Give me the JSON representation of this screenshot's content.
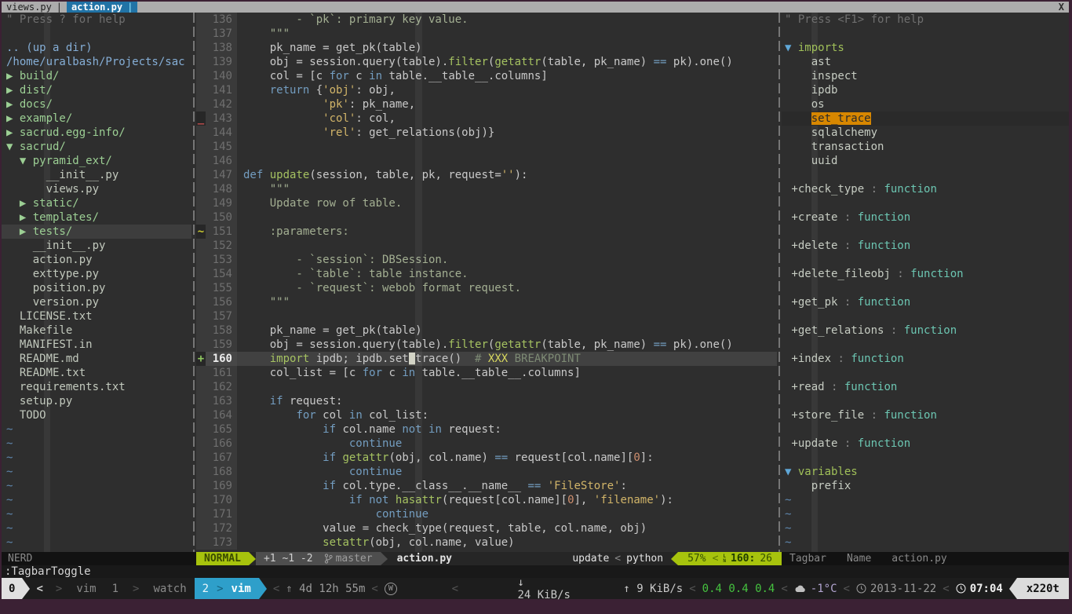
{
  "colors": {
    "accent_green": "#a7c30d",
    "tab_blue": "#2173a6",
    "tag_highlight_orange": "#d78700",
    "tmux_cyan": "#2e9fca",
    "load_green": "#45c33f",
    "temp_lavender": "#b2a4d0",
    "sign_add": "#8fc860",
    "sign_delete": "#c75050",
    "sign_change": "#c9c930"
  },
  "tabline": {
    "tabs": [
      {
        "name": "views.py",
        "pipe": "|",
        "active": false
      },
      {
        "name": "action.py",
        "pipe": "|",
        "active": true
      }
    ],
    "close_label": "X"
  },
  "nerdtree": {
    "help": "\" Press ? for help",
    "up_dir": ".. (up a dir)",
    "root_path": "/home/uralbash/Projects/sac",
    "items": [
      {
        "text": "build/",
        "kind": "dir",
        "prefix": "▶ ",
        "pad": 0
      },
      {
        "text": "dist/",
        "kind": "dir",
        "prefix": "▶ ",
        "pad": 0
      },
      {
        "text": "docs/",
        "kind": "dir",
        "prefix": "▶ ",
        "pad": 0
      },
      {
        "text": "example/",
        "kind": "dir",
        "prefix": "▶ ",
        "pad": 0
      },
      {
        "text": "sacrud.egg-info/",
        "kind": "dir",
        "prefix": "▶ ",
        "pad": 0
      },
      {
        "text": "sacrud/",
        "kind": "dir",
        "prefix": "▼ ",
        "pad": 0
      },
      {
        "text": "pyramid_ext/",
        "kind": "dir",
        "prefix": "▼ ",
        "pad": 1
      },
      {
        "text": "__init__.py",
        "kind": "file",
        "prefix": "",
        "pad": 3
      },
      {
        "text": "views.py",
        "kind": "file",
        "prefix": "",
        "pad": 3
      },
      {
        "text": "static/",
        "kind": "dir",
        "prefix": "▶ ",
        "pad": 1
      },
      {
        "text": "templates/",
        "kind": "dir",
        "prefix": "▶ ",
        "pad": 1
      },
      {
        "text": "tests/",
        "kind": "dir",
        "prefix": "▶ ",
        "pad": 1,
        "cursorline": true
      },
      {
        "text": "__init__.py",
        "kind": "file",
        "prefix": "",
        "pad": 2
      },
      {
        "text": "action.py",
        "kind": "file",
        "prefix": "",
        "pad": 2
      },
      {
        "text": "exttype.py",
        "kind": "file",
        "prefix": "",
        "pad": 2
      },
      {
        "text": "position.py",
        "kind": "file",
        "prefix": "",
        "pad": 2
      },
      {
        "text": "version.py",
        "kind": "file",
        "prefix": "",
        "pad": 2
      },
      {
        "text": "LICENSE.txt",
        "kind": "file",
        "prefix": "",
        "pad": 1
      },
      {
        "text": "Makefile",
        "kind": "file",
        "prefix": "",
        "pad": 1
      },
      {
        "text": "MANIFEST.in",
        "kind": "file",
        "prefix": "",
        "pad": 1
      },
      {
        "text": "README.md",
        "kind": "file",
        "prefix": "",
        "pad": 1
      },
      {
        "text": "README.txt",
        "kind": "file",
        "prefix": "",
        "pad": 1
      },
      {
        "text": "requirements.txt",
        "kind": "file",
        "prefix": "",
        "pad": 1
      },
      {
        "text": "setup.py",
        "kind": "file",
        "prefix": "",
        "pad": 1
      },
      {
        "text": "TODO",
        "kind": "file",
        "prefix": "",
        "pad": 1
      }
    ],
    "tilde_rows": 9,
    "statusline": "NERD"
  },
  "editor": {
    "first_line": 136,
    "cursor_line": 160,
    "cursor_col": 26,
    "signs": {
      "143": [
        "_",
        "del"
      ],
      "151": [
        "~",
        "mod"
      ],
      "160": [
        "+",
        "add"
      ]
    },
    "lines": [
      {
        "n": 136,
        "t": [
          [
            "g",
            "        - `pk`: primary key value."
          ]
        ]
      },
      {
        "n": 137,
        "t": [
          [
            "g",
            "    \"\"\""
          ]
        ]
      },
      {
        "n": 138,
        "t": [
          [
            "d",
            "    pk_name = get_pk(table)"
          ]
        ]
      },
      {
        "n": 139,
        "t": [
          [
            "d",
            "    obj = session.query(table)."
          ],
          [
            "f",
            "filter"
          ],
          [
            "d",
            "("
          ],
          [
            "f",
            "getattr"
          ],
          [
            "d",
            "(table, pk_name) "
          ],
          [
            "k",
            "=="
          ],
          [
            "d",
            " pk).one()"
          ]
        ]
      },
      {
        "n": 140,
        "t": [
          [
            "d",
            "    col = [c "
          ],
          [
            "k",
            "for"
          ],
          [
            "d",
            " c "
          ],
          [
            "k",
            "in"
          ],
          [
            "d",
            " table.__table__.columns]"
          ]
        ]
      },
      {
        "n": 141,
        "t": [
          [
            "k",
            "    return"
          ],
          [
            "d",
            " {"
          ],
          [
            "s",
            "'obj'"
          ],
          [
            "d",
            ": obj,"
          ]
        ]
      },
      {
        "n": 142,
        "t": [
          [
            "d",
            "            "
          ],
          [
            "s",
            "'pk'"
          ],
          [
            "d",
            ": pk_name,"
          ]
        ]
      },
      {
        "n": 143,
        "t": [
          [
            "d",
            "            "
          ],
          [
            "s",
            "'col'"
          ],
          [
            "d",
            ": col,"
          ]
        ]
      },
      {
        "n": 144,
        "t": [
          [
            "d",
            "            "
          ],
          [
            "s",
            "'rel'"
          ],
          [
            "d",
            ": get_relations(obj)}"
          ]
        ]
      },
      {
        "n": 145,
        "t": []
      },
      {
        "n": 146,
        "t": []
      },
      {
        "n": 147,
        "t": [
          [
            "k",
            "def"
          ],
          [
            "d",
            " "
          ],
          [
            "f",
            "update"
          ],
          [
            "d",
            "(session, table, pk, request="
          ],
          [
            "s",
            "''"
          ],
          [
            "d",
            "):"
          ]
        ]
      },
      {
        "n": 148,
        "t": [
          [
            "g",
            "    \"\"\""
          ]
        ]
      },
      {
        "n": 149,
        "t": [
          [
            "g",
            "    Update row of table."
          ]
        ]
      },
      {
        "n": 150,
        "t": []
      },
      {
        "n": 151,
        "t": [
          [
            "g",
            "    :parameters:"
          ]
        ]
      },
      {
        "n": 152,
        "t": []
      },
      {
        "n": 153,
        "t": [
          [
            "g",
            "        - `session`: DBSession."
          ]
        ]
      },
      {
        "n": 154,
        "t": [
          [
            "g",
            "        - `table`: table instance."
          ]
        ]
      },
      {
        "n": 155,
        "t": [
          [
            "g",
            "        - `request`: webob format request."
          ]
        ]
      },
      {
        "n": 156,
        "t": [
          [
            "g",
            "    \"\"\""
          ]
        ]
      },
      {
        "n": 157,
        "t": []
      },
      {
        "n": 158,
        "t": [
          [
            "d",
            "    pk_name = get_pk(table)"
          ]
        ]
      },
      {
        "n": 159,
        "t": [
          [
            "d",
            "    obj = session.query(table)."
          ],
          [
            "f",
            "filter"
          ],
          [
            "d",
            "("
          ],
          [
            "f",
            "getattr"
          ],
          [
            "d",
            "(table, pk_name) "
          ],
          [
            "k",
            "=="
          ],
          [
            "d",
            " pk).one()"
          ]
        ]
      },
      {
        "n": 160,
        "t": [
          [
            "f",
            "    import"
          ],
          [
            "d",
            " ipdb; ipdb.set"
          ],
          [
            "u",
            "_"
          ],
          [
            "d",
            "trace()  "
          ],
          [
            "c",
            "# "
          ],
          [
            "x",
            "XXX"
          ],
          [
            "c",
            " BREAKPOINT"
          ]
        ]
      },
      {
        "n": 161,
        "t": [
          [
            "d",
            "    col_list = [c "
          ],
          [
            "k",
            "for"
          ],
          [
            "d",
            " c "
          ],
          [
            "k",
            "in"
          ],
          [
            "d",
            " table.__table__.columns]"
          ]
        ]
      },
      {
        "n": 162,
        "t": []
      },
      {
        "n": 163,
        "t": [
          [
            "k",
            "    if"
          ],
          [
            "d",
            " request:"
          ]
        ]
      },
      {
        "n": 164,
        "t": [
          [
            "d",
            "        "
          ],
          [
            "k",
            "for"
          ],
          [
            "d",
            " col "
          ],
          [
            "k",
            "in"
          ],
          [
            "d",
            " col_list:"
          ]
        ]
      },
      {
        "n": 165,
        "t": [
          [
            "d",
            "            "
          ],
          [
            "k",
            "if"
          ],
          [
            "d",
            " col.name "
          ],
          [
            "k",
            "not in"
          ],
          [
            "d",
            " request:"
          ]
        ]
      },
      {
        "n": 166,
        "t": [
          [
            "d",
            "                "
          ],
          [
            "k",
            "continue"
          ]
        ]
      },
      {
        "n": 167,
        "t": [
          [
            "d",
            "            "
          ],
          [
            "k",
            "if"
          ],
          [
            "d",
            " "
          ],
          [
            "f",
            "getattr"
          ],
          [
            "d",
            "(obj, col.name) "
          ],
          [
            "k",
            "=="
          ],
          [
            "d",
            " request[col.name]["
          ],
          [
            "n",
            "0"
          ],
          [
            "d",
            "]:"
          ]
        ]
      },
      {
        "n": 168,
        "t": [
          [
            "d",
            "                "
          ],
          [
            "k",
            "continue"
          ]
        ]
      },
      {
        "n": 169,
        "t": [
          [
            "d",
            "            "
          ],
          [
            "k",
            "if"
          ],
          [
            "d",
            " col.type.__class__.__name__ "
          ],
          [
            "k",
            "=="
          ],
          [
            "d",
            " "
          ],
          [
            "s",
            "'FileStore'"
          ],
          [
            "d",
            ":"
          ]
        ]
      },
      {
        "n": 170,
        "t": [
          [
            "d",
            "                "
          ],
          [
            "k",
            "if"
          ],
          [
            "d",
            " "
          ],
          [
            "k",
            "not"
          ],
          [
            "d",
            " "
          ],
          [
            "f",
            "hasattr"
          ],
          [
            "d",
            "(request[col.name]["
          ],
          [
            "n",
            "0"
          ],
          [
            "d",
            "], "
          ],
          [
            "s",
            "'filename'"
          ],
          [
            "d",
            "):"
          ]
        ]
      },
      {
        "n": 171,
        "t": [
          [
            "d",
            "                    "
          ],
          [
            "k",
            "continue"
          ]
        ]
      },
      {
        "n": 172,
        "t": [
          [
            "d",
            "            value = check_type(request, table, col.name, obj)"
          ]
        ]
      },
      {
        "n": 173,
        "t": [
          [
            "d",
            "            "
          ],
          [
            "f",
            "setattr"
          ],
          [
            "d",
            "(obj, col.name, value)"
          ]
        ]
      }
    ]
  },
  "statusline": {
    "mode": "NORMAL",
    "changes": "+1 ~1 -2",
    "branch": "master",
    "file": "action.py",
    "tag": "update",
    "sep": "<",
    "filetype": "python",
    "percent": "57%",
    "line": "160:",
    "col": "26"
  },
  "tagbar": {
    "help": "\" Press <F1> for help",
    "rows": [
      {
        "type": "kind",
        "label": "imports"
      },
      {
        "type": "tag",
        "label": "ast"
      },
      {
        "type": "tag",
        "label": "inspect"
      },
      {
        "type": "tag",
        "label": "ipdb"
      },
      {
        "type": "tag",
        "label": "os"
      },
      {
        "type": "tag",
        "label": "set_trace",
        "highlight": true
      },
      {
        "type": "tag",
        "label": "sqlalchemy"
      },
      {
        "type": "tag",
        "label": "transaction"
      },
      {
        "type": "tag",
        "label": "uuid"
      },
      {
        "type": "blank"
      },
      {
        "type": "func",
        "label": "+check_type",
        "sep": " : ",
        "kindtype": "function"
      },
      {
        "type": "blank"
      },
      {
        "type": "func",
        "label": "+create",
        "sep": " : ",
        "kindtype": "function"
      },
      {
        "type": "blank"
      },
      {
        "type": "func",
        "label": "+delete",
        "sep": " : ",
        "kindtype": "function"
      },
      {
        "type": "blank"
      },
      {
        "type": "func",
        "label": "+delete_fileobj",
        "sep": " : ",
        "kindtype": "function"
      },
      {
        "type": "blank"
      },
      {
        "type": "func",
        "label": "+get_pk",
        "sep": " : ",
        "kindtype": "function"
      },
      {
        "type": "blank"
      },
      {
        "type": "func",
        "label": "+get_relations",
        "sep": " : ",
        "kindtype": "function"
      },
      {
        "type": "blank"
      },
      {
        "type": "func",
        "label": "+index",
        "sep": " : ",
        "kindtype": "function"
      },
      {
        "type": "blank"
      },
      {
        "type": "func",
        "label": "+read",
        "sep": " : ",
        "kindtype": "function"
      },
      {
        "type": "blank"
      },
      {
        "type": "func",
        "label": "+store_file",
        "sep": " : ",
        "kindtype": "function"
      },
      {
        "type": "blank"
      },
      {
        "type": "func",
        "label": "+update",
        "sep": " : ",
        "kindtype": "function"
      },
      {
        "type": "blank"
      },
      {
        "type": "kind",
        "label": "variables"
      },
      {
        "type": "tag",
        "label": "prefix"
      }
    ],
    "tilde_rows": 4,
    "statusline": {
      "plugin": "Tagbar",
      "sort": "Name",
      "file": "action.py"
    }
  },
  "cmdline": ":TagbarToggle",
  "tmux": {
    "session": "0",
    "window_strip": [
      {
        "t": "<",
        "c": "lt"
      },
      {
        "t": ">",
        "c": "sep"
      },
      {
        "t": "vim",
        "c": "win"
      },
      {
        "t": "1",
        "c": "win"
      },
      {
        "t": ">",
        "c": "sep"
      },
      {
        "t": "watch",
        "c": "win"
      }
    ],
    "active_window": {
      "index": "2",
      "isep": ">",
      "name": "vim"
    },
    "uptime_icon": "⇑",
    "uptime": "4d 12h 55m",
    "wifi_letter": "W",
    "net_down_icon": "↓",
    "net_down": "24 KiB/s",
    "net_up_icon": "↑",
    "net_up": "9 KiB/s",
    "load": "0.4 0.4 0.4",
    "temp": "-1°C",
    "date": "2013-11-22",
    "time": "07:04",
    "host": "x220t",
    "sep": "<"
  }
}
